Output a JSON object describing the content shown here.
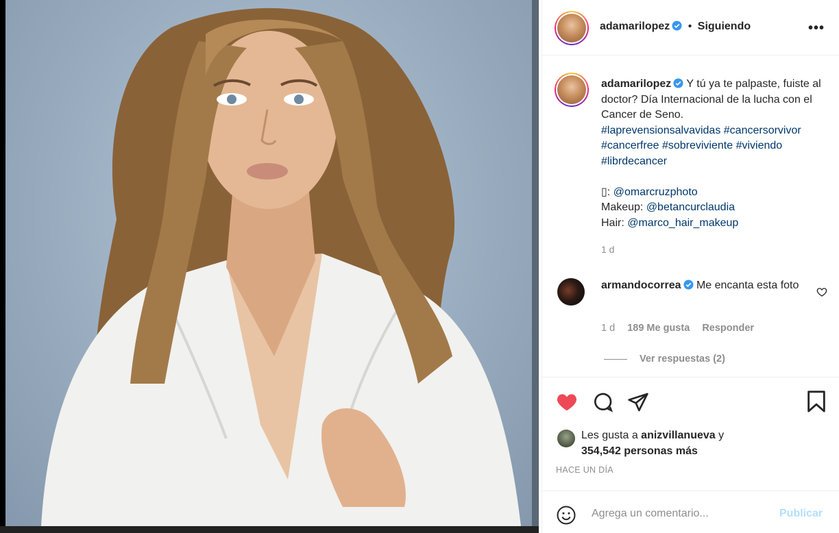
{
  "post": {
    "image_alt": "",
    "username": "adamarilopez",
    "separator": "•",
    "follow_status": "Siguiendo",
    "more_label": "•••"
  },
  "caption": {
    "username": "adamarilopez",
    "text": "Y tú ya te palpaste, fuiste al doctor? Día Internacional de la lucha con el Cancer de Seno.",
    "hashtags": [
      "#laprevensionsalvavidas",
      "#cancersorvivor",
      "#cancerfree",
      "#sobreviviente",
      "#viviendo",
      "#librdecancer"
    ],
    "credit_photo_prefix": "▯: ",
    "credit_photo": "@omarcruzphoto",
    "credit_makeup_prefix": "Makeup: ",
    "credit_makeup": "@betancurclaudia",
    "credit_hair_prefix": "Hair: ",
    "credit_hair": "@marco_hair_makeup",
    "time": "1 d"
  },
  "comment": {
    "username": "armandocorrea",
    "text": "Me encanta esta foto",
    "time": "1 d",
    "likes": "189 Me gusta",
    "reply": "Responder",
    "view_replies": "Ver respuestas (2)"
  },
  "likes": {
    "prefix": "Les gusta a ",
    "user": "anizvillanueva",
    "middle": " y",
    "count": "354,542 personas más",
    "ago": "HACE UN DÍA"
  },
  "comment_box": {
    "placeholder": "Agrega un comentario...",
    "publish": "Publicar"
  },
  "colors": {
    "like": "#ed4956",
    "link": "#00376b",
    "verified": "#3897f0",
    "publish_disabled": "#b2dffc"
  }
}
